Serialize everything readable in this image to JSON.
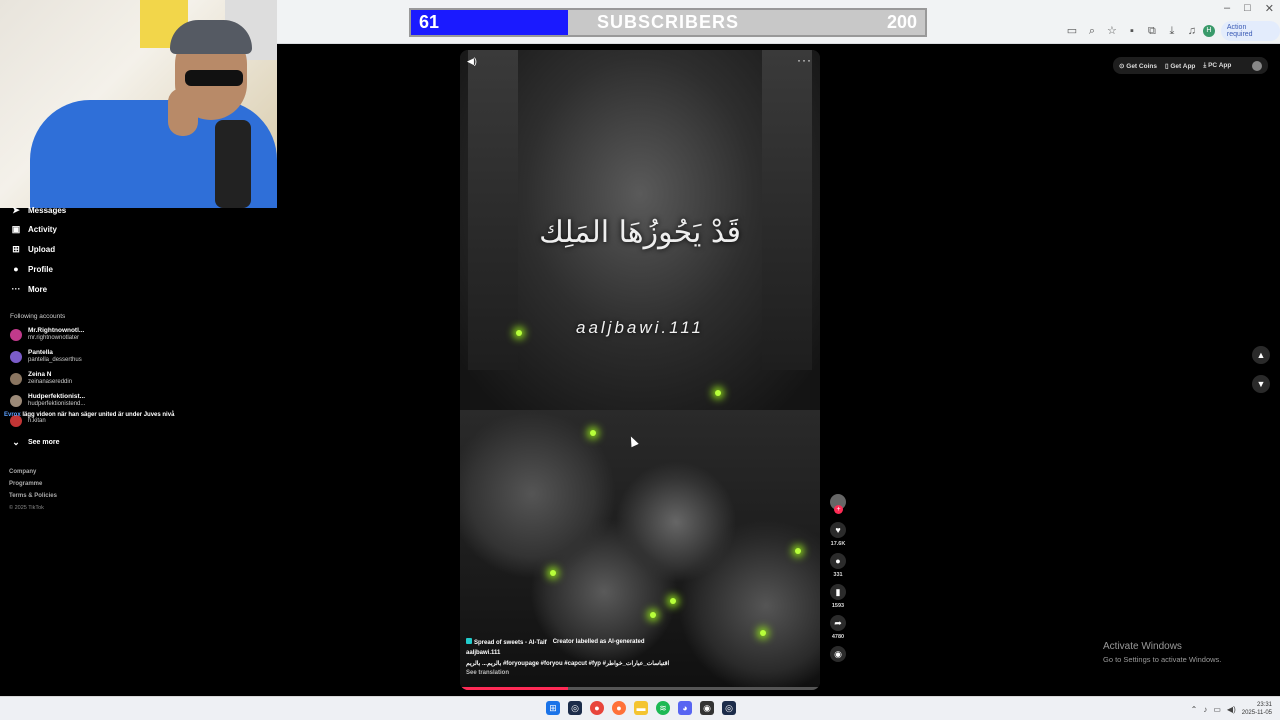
{
  "browser": {
    "action_required": "Action required",
    "window_controls": [
      "–",
      "□",
      "✕"
    ]
  },
  "subscriber_goal": {
    "current": "61",
    "label": "SUBSCRIBERS",
    "goal": "200",
    "progress_fraction": 0.305,
    "fill_color": "#1a1aff"
  },
  "sidebar": {
    "nav": [
      {
        "label": "Messages",
        "icon": "paper-plane-icon"
      },
      {
        "label": "Activity",
        "icon": "inbox-icon"
      },
      {
        "label": "Upload",
        "icon": "plus-square-icon"
      },
      {
        "label": "Profile",
        "icon": "avatar-icon"
      },
      {
        "label": "More",
        "icon": "ellipsis-icon"
      }
    ],
    "following_header": "Following accounts",
    "accounts": [
      {
        "name": "Mr.Rightnownotl...",
        "handle": "mr.rightnownotlater",
        "color": "#c13a8b"
      },
      {
        "name": "Pantella",
        "handle": "pantella_desserthus",
        "color": "#7b5cc9"
      },
      {
        "name": "Zeina N",
        "handle": "zeinanasereddin",
        "color": "#8a7560"
      },
      {
        "name": "Hudperfektionist...",
        "handle": "hudperfektionistend...",
        "color": "#9c8a78"
      },
      {
        "name": "",
        "handle": "h.kitan",
        "color": "#c23535"
      }
    ],
    "see_more": "See more",
    "footer": [
      "Company",
      "Programme",
      "Terms & Policies"
    ],
    "copyright": "© 2025 TikTok"
  },
  "chat_overlay": {
    "user": "Evrox",
    "message": "lägg videon när han säger united är under Juves nivå"
  },
  "video": {
    "arabic_caption": "قَدْ يَحُوزُهَا المَلِك",
    "watermark": "aaljbawi.111",
    "music": "Spread of sweets - Al-Taif",
    "ai_label": "Creator labelled as AI-generated",
    "author": "aaljbawi.111",
    "description": "بالريم... بالريم #foryoupage #foryou #capcut #fyp #اقتباسات_عبارات_خواطر",
    "see_translation": "See translation",
    "progress_fraction": 0.3
  },
  "actions": [
    {
      "icon": "heart-icon",
      "glyph": "♥",
      "count": "17.6K"
    },
    {
      "icon": "comment-icon",
      "glyph": "●",
      "count": "331"
    },
    {
      "icon": "bookmark-icon",
      "glyph": "▮",
      "count": "1593"
    },
    {
      "icon": "share-icon",
      "glyph": "➦",
      "count": "4780"
    }
  ],
  "top_right": {
    "get_coins": "Get Coins",
    "get_app": "Get App",
    "pc_app": "PC App"
  },
  "activate_windows": {
    "title": "Activate Windows",
    "subtitle": "Go to Settings to activate Windows."
  },
  "clock": {
    "time": "23:31",
    "date": "2025-11-05"
  }
}
